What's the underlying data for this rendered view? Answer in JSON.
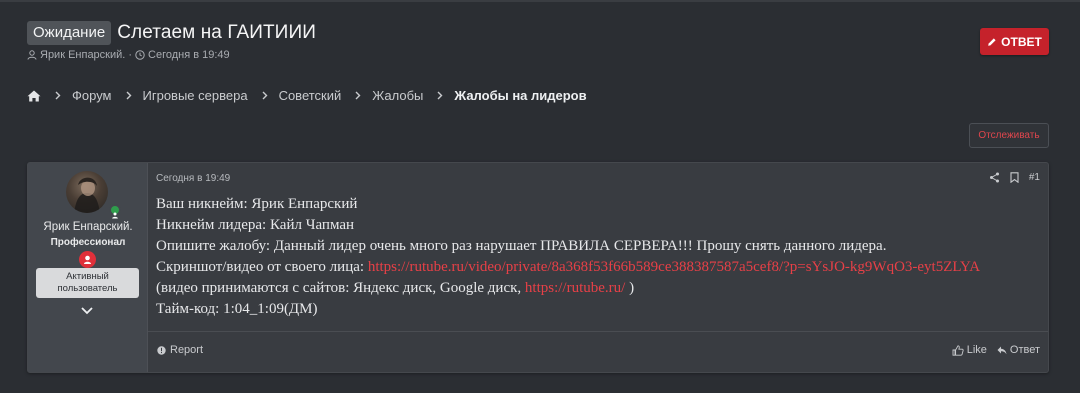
{
  "thread": {
    "status_label": "Ожидание",
    "title": "Слетаем на ГАИТИИИ",
    "author": "Ярик Енпарский.",
    "date": "Сегодня в 19:49",
    "reply_button": "ОТВЕТ",
    "watch_button": "Отслеживать"
  },
  "breadcrumb": {
    "items": [
      "Форум",
      "Игровые сервера",
      "Советский",
      "Жалобы",
      "Жалобы на лидеров"
    ]
  },
  "post": {
    "username": "Ярик Енпарский.",
    "user_title": "Профессионал",
    "badge": "Активный пользователь",
    "badge_line1": "Активный",
    "badge_line2": "пользователь",
    "date": "Сегодня в 19:49",
    "post_number": "#1",
    "lines": {
      "l1": "Ваш никнейм: Ярик Енпарский",
      "l2": "Никнейм лидера: Кайл Чапман",
      "l3": "Опишите жалобу: Данный лидер очень много раз нарушает ПРАВИЛА СЕРВЕРА!!! Прошу снять данного лидера.",
      "l4_prefix": "Скриншот/видео от своего лица: ",
      "l4_link": "https://rutube.ru/video/private/8a368f53f66b589ce388387587a5cef8/?p=sYsJO-kg9WqO3-eyt5ZLYA",
      "l5_prefix": "(видео принимаются с сайтов: Яндекс диск, Google диск, ",
      "l5_link": "https://rutube.ru/",
      "l5_suffix": " )",
      "l6": "Тайм-код: 1:04_1:09(ДМ)"
    },
    "footer": {
      "report": "Report",
      "like": "Like",
      "reply": "Ответ"
    }
  },
  "colors": {
    "accent": "#c5222b",
    "link": "#e74047",
    "background": "#2b2e33",
    "post_background": "#393c41"
  },
  "icons": [
    "user-icon",
    "clock-icon",
    "pencil-icon",
    "home-icon",
    "chevron-right-icon",
    "share-icon",
    "bookmark-icon",
    "report-icon",
    "like-icon",
    "reply-arrow-icon",
    "chevron-down-icon",
    "badge-icon"
  ]
}
